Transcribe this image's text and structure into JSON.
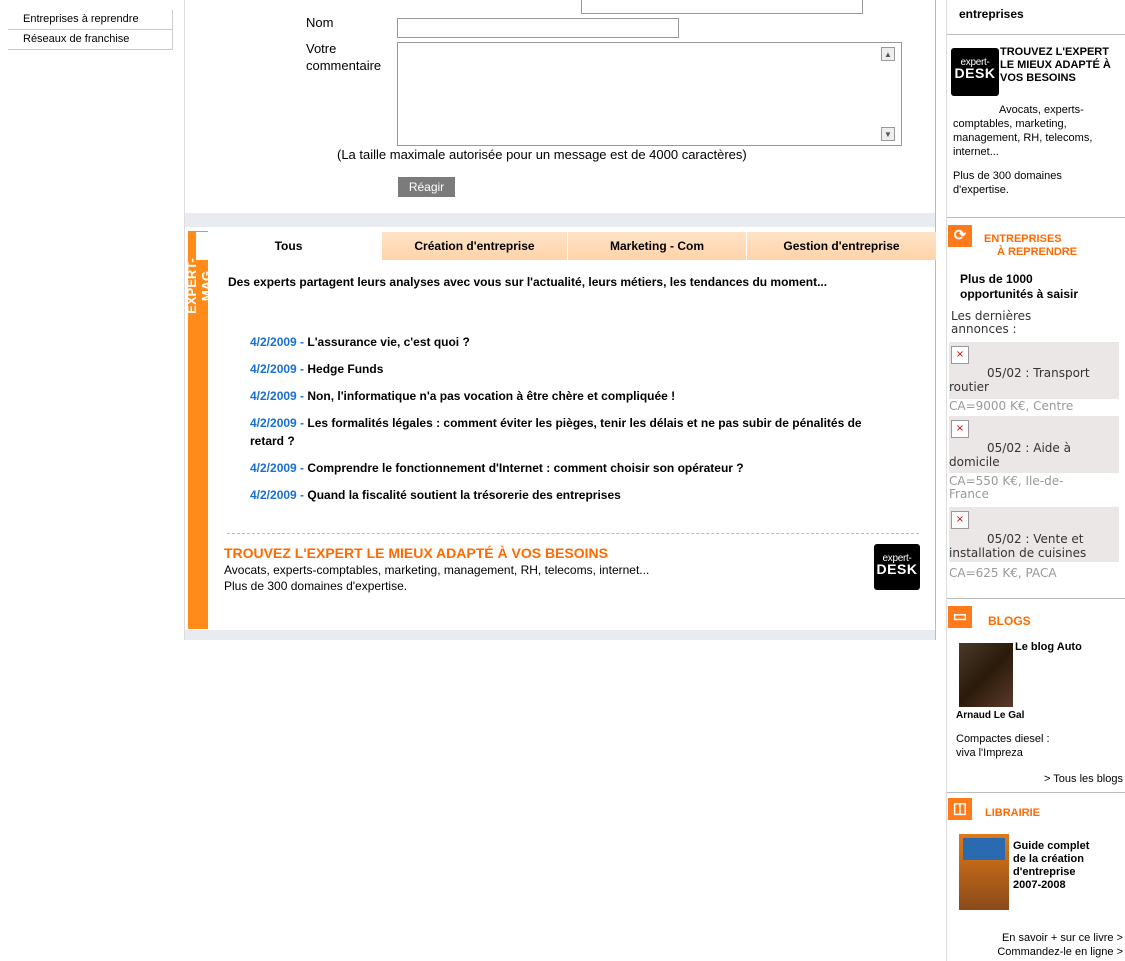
{
  "left_nav": {
    "items": [
      {
        "label": "Entreprises à reprendre"
      },
      {
        "label": "Réseaux de franchise"
      }
    ]
  },
  "form": {
    "name_label": "Nom",
    "comment_label": "Votre commentaire",
    "name_value": "",
    "comment_value": "",
    "max_size_note": "(La taille maximale autorisée pour un message est de 4000 caractères)",
    "submit_label": "Réagir"
  },
  "expert_mag": {
    "strip_label": "EXPERT-MAG",
    "tabs": [
      {
        "label": "Tous",
        "active": true
      },
      {
        "label": "Création d'entreprise",
        "active": false
      },
      {
        "label": "Marketing - Com",
        "active": false
      },
      {
        "label": "Gestion d'entreprise",
        "active": false
      }
    ],
    "intro": "Des experts partagent leurs analyses avec vous sur l'actualité, leurs métiers, les tendances du moment...",
    "articles": [
      {
        "date": "4/2/2009 - ",
        "title": "L'assurance vie, c'est quoi ?"
      },
      {
        "date": "4/2/2009 - ",
        "title": "Hedge Funds"
      },
      {
        "date": "4/2/2009 - ",
        "title": "Non, l'informatique n'a pas vocation à être chère et compliquée !"
      },
      {
        "date": "4/2/2009 - ",
        "title": "Les formalités légales : comment éviter les pièges, tenir les délais et ne pas subir de pénalités de retard ?"
      },
      {
        "date": "4/2/2009 - ",
        "title": "Comprendre le fonctionnement d'Internet : comment choisir son opérateur ?"
      },
      {
        "date": "4/2/2009 - ",
        "title": "Quand la fiscalité soutient la trésorerie des entreprises"
      }
    ],
    "promo": {
      "title": "TROUVEZ L'EXPERT LE MIEUX ADAPTÉ À VOS BESOINS",
      "text1": "Avocats, experts-comptables, marketing, management, RH, telecoms, internet...",
      "text2": "Plus de 300 domaines d'expertise."
    }
  },
  "logo": {
    "line1": "expert-",
    "line2": "DESK"
  },
  "right": {
    "top_partial": "entreprises",
    "expert": {
      "title": "TROUVEZ L'EXPERT LE MIEUX ADAPTÉ À VOS BESOINS",
      "text1": "Avocats, experts-comptables, marketing, management, RH, telecoms, internet...",
      "text2": "Plus de 300 domaines d'expertise."
    },
    "entreprises": {
      "title_line1": "ENTREPRISES",
      "title_line2": "À REPRENDRE",
      "subtitle": "Plus de 1000 opportunités à saisir",
      "latest": "Les dernières annonces :",
      "listings": [
        {
          "text": "05/02 : Transport routier",
          "sub": "CA=9000 K€, Centre"
        },
        {
          "text": "05/02 : Aide à domicile",
          "sub": "CA=550 K€, Ile-de-France"
        },
        {
          "text": "05/02 : Vente et installation de cuisines",
          "sub": "CA=625 K€, PACA"
        }
      ]
    },
    "blogs": {
      "title": "BLOGS",
      "blog_name": "Le blog Auto",
      "author": "Arnaud Le Gal",
      "post": "Compactes diesel : viva l'Impreza",
      "all_link": "> Tous les blogs"
    },
    "librairie": {
      "title": "LIBRAIRIE",
      "book_title": "Guide complet de la création d'entreprise 2007-2008",
      "link1": "En savoir + sur ce livre >",
      "link2": "Commandez-le en ligne >"
    }
  },
  "colors": {
    "orange": "#ff6a00",
    "blue_date": "#1a6fd1",
    "strip": "#ff8c1a"
  }
}
